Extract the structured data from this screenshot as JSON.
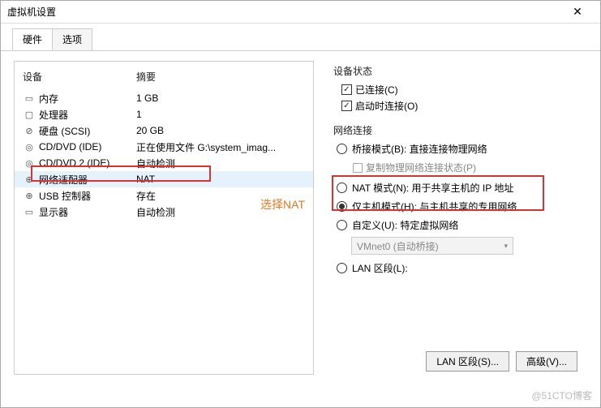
{
  "window": {
    "title": "虚拟机设置"
  },
  "tabs": {
    "hardware": "硬件",
    "options": "选项"
  },
  "table": {
    "device_header": "设备",
    "summary_header": "摘要"
  },
  "devices": [
    {
      "icon": "▭",
      "name": "内存",
      "summary": "1 GB"
    },
    {
      "icon": "▢",
      "name": "处理器",
      "summary": "1"
    },
    {
      "icon": "⊘",
      "name": "硬盘 (SCSI)",
      "summary": "20 GB"
    },
    {
      "icon": "◎",
      "name": "CD/DVD (IDE)",
      "summary": "正在使用文件 G:\\system_imag..."
    },
    {
      "icon": "◎",
      "name": "CD/DVD 2 (IDE)",
      "summary": "自动检测"
    },
    {
      "icon": "⊕",
      "name": "网络适配器",
      "summary": "NAT"
    },
    {
      "icon": "⊕",
      "name": "USB 控制器",
      "summary": "存在"
    },
    {
      "icon": "▭",
      "name": "显示器",
      "summary": "自动检测"
    }
  ],
  "annotation": "选择NAT",
  "right": {
    "status_label": "设备状态",
    "connected": "已连接(C)",
    "connect_at_power": "启动时连接(O)",
    "net_label": "网络连接",
    "bridged": "桥接模式(B): 直接连接物理网络",
    "replicate": "复制物理网络连接状态(P)",
    "nat": "NAT 模式(N): 用于共享主机的 IP 地址",
    "hostonly": "仅主机模式(H): 与主机共享的专用网络",
    "custom": "自定义(U): 特定虚拟网络",
    "vmnet": "VMnet0 (自动桥接)",
    "lanseg": "LAN 区段(L):",
    "btn_lanseg": "LAN 区段(S)...",
    "btn_adv": "高级(V)..."
  },
  "watermark": "@51CTO博客"
}
